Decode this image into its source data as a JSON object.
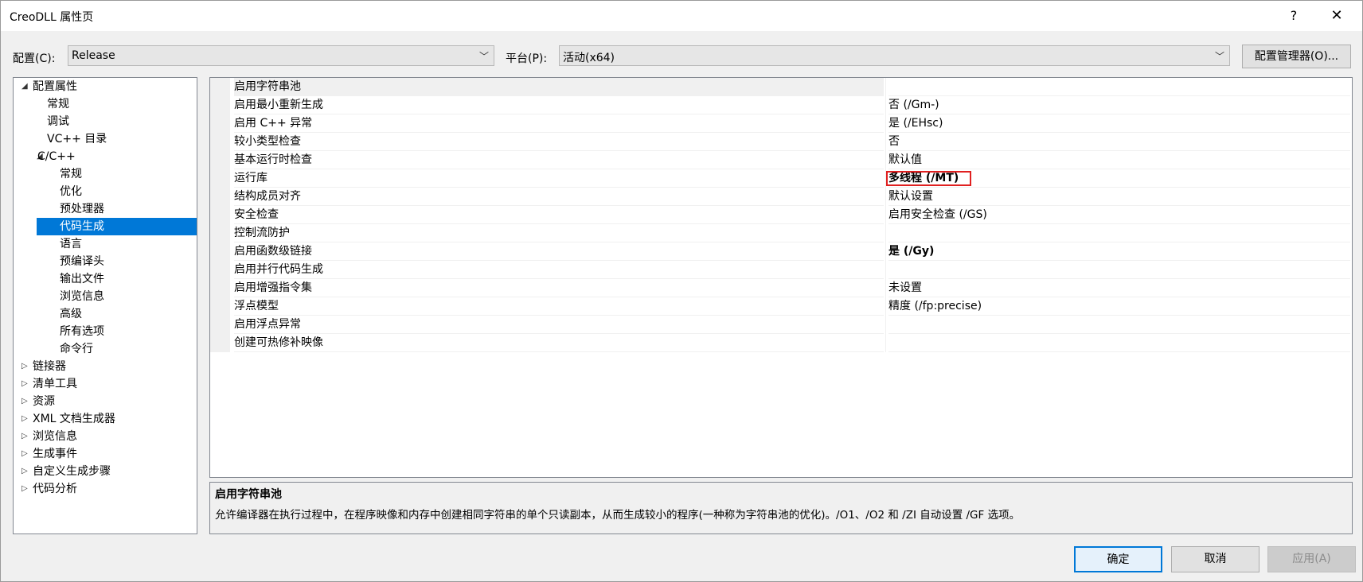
{
  "window": {
    "title": "CreoDLL 属性页",
    "help_label": "?",
    "close_label": "✕"
  },
  "config": {
    "config_label": "配置(C):",
    "config_value": "Release",
    "platform_label": "平台(P):",
    "platform_value": "活动(x64)",
    "manager_button": "配置管理器(O)...",
    "arrow": "﹀"
  },
  "tree": {
    "items": [
      {
        "label": "配置属性",
        "expander": "◢"
      },
      {
        "label": "常规"
      },
      {
        "label": "调试"
      },
      {
        "label": "VC++ 目录"
      },
      {
        "label": "C/C++",
        "expander": "◢"
      },
      {
        "label": "常规"
      },
      {
        "label": "优化"
      },
      {
        "label": "预处理器"
      },
      {
        "label": "代码生成",
        "selected": true
      },
      {
        "label": "语言"
      },
      {
        "label": "预编译头"
      },
      {
        "label": "输出文件"
      },
      {
        "label": "浏览信息"
      },
      {
        "label": "高级"
      },
      {
        "label": "所有选项"
      },
      {
        "label": "命令行"
      },
      {
        "label": "链接器",
        "expander": "▷"
      },
      {
        "label": "清单工具",
        "expander": "▷"
      },
      {
        "label": "资源",
        "expander": "▷"
      },
      {
        "label": "XML 文档生成器",
        "expander": "▷"
      },
      {
        "label": "浏览信息",
        "expander": "▷"
      },
      {
        "label": "生成事件",
        "expander": "▷"
      },
      {
        "label": "自定义生成步骤",
        "expander": "▷"
      },
      {
        "label": "代码分析",
        "expander": "▷"
      }
    ]
  },
  "properties": [
    {
      "name": "启用字符串池",
      "value": ""
    },
    {
      "name": "启用最小重新生成",
      "value": "否 (/Gm-)"
    },
    {
      "name": "启用 C++ 异常",
      "value": "是 (/EHsc)"
    },
    {
      "name": "较小类型检查",
      "value": "否"
    },
    {
      "name": "基本运行时检查",
      "value": "默认值"
    },
    {
      "name": "运行库",
      "value": "多线程 (/MT)",
      "bold": true,
      "highlighted": true
    },
    {
      "name": "结构成员对齐",
      "value": "默认设置"
    },
    {
      "name": "安全检查",
      "value": "启用安全检查 (/GS)"
    },
    {
      "name": "控制流防护",
      "value": ""
    },
    {
      "name": "启用函数级链接",
      "value": "是 (/Gy)",
      "bold": true
    },
    {
      "name": "启用并行代码生成",
      "value": ""
    },
    {
      "name": "启用增强指令集",
      "value": "未设置"
    },
    {
      "name": "浮点模型",
      "value": "精度 (/fp:precise)"
    },
    {
      "name": "启用浮点异常",
      "value": ""
    },
    {
      "name": "创建可热修补映像",
      "value": ""
    }
  ],
  "description": {
    "title": "启用字符串池",
    "text": "允许编译器在执行过程中，在程序映像和内存中创建相同字符串的单个只读副本，从而生成较小的程序(一种称为字符串池的优化)。/O1、/O2 和 /ZI 自动设置 /GF 选项。"
  },
  "buttons": {
    "ok": "确定",
    "cancel": "取消",
    "apply": "应用(A)"
  },
  "colors": {
    "accent": "#0078d7",
    "highlight_border": "#e02020"
  }
}
